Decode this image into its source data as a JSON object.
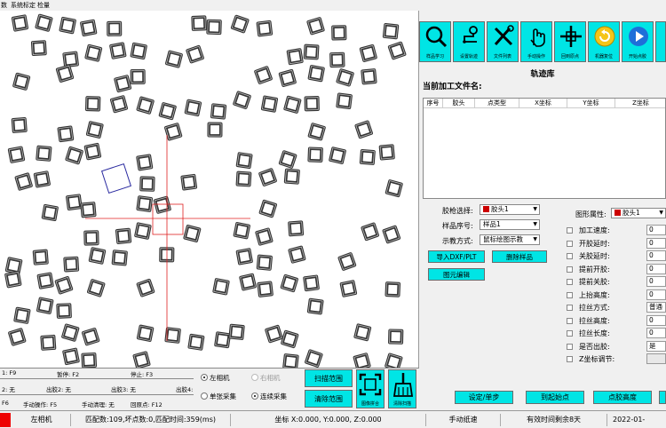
{
  "menu": {
    "items": [
      "数",
      "系统标定",
      "检量"
    ]
  },
  "info": {
    "row1": [
      "1: F9",
      "暂停: F2",
      "停止: F3"
    ],
    "row2": [
      "2: 无",
      "出胶2: 无",
      "出胶3: 无",
      "出胶4:"
    ],
    "row3": [
      "F6",
      "手动操作: F5",
      "手动清理: 无",
      "回原点: F12"
    ]
  },
  "camera_options": {
    "left_camera": "左相机",
    "right_camera": "右相机",
    "single_capture": "单张采集",
    "continuous_capture": "连续采集"
  },
  "buttons": {
    "scan_range": "扫描范围",
    "clear_range": "清除范围",
    "image_stitch": "图像拼合",
    "clear_scan": "清除扫描",
    "import_dxf": "导入DXF/PLT",
    "delete_sample": "删除样品",
    "edit_element": "图元编辑",
    "set_step": "设定/单步",
    "to_start": "到起始点",
    "glue_height": "点胶高度"
  },
  "toolbar": [
    {
      "label": "样品学习",
      "icon": "search-icon"
    },
    {
      "label": "设置轨迹",
      "icon": "route-icon"
    },
    {
      "label": "文件列表",
      "icon": "tools-icon"
    },
    {
      "label": "手动操作",
      "icon": "hand-icon"
    },
    {
      "label": "回到原点",
      "icon": "crosshair-icon"
    },
    {
      "label": "机器复位",
      "icon": "reset-icon"
    },
    {
      "label": "开始点胶",
      "icon": "play-icon"
    }
  ],
  "track": {
    "title": "轨迹库",
    "file_label": "当前加工文件名:",
    "columns": [
      "序号",
      "胶头",
      "点类型",
      "X坐标",
      "Y坐标",
      "Z坐标"
    ]
  },
  "form": {
    "glue_gun_label": "胶枪选择:",
    "glue_gun_value": "胶头1",
    "sample_no_label": "样品序号:",
    "sample_no_value": "样品1",
    "display_mode_label": "示教方式:",
    "display_mode_value": "鼠标绘图示教",
    "shape_attr_label": "图形属性:",
    "shape_attr_value": "胶头1"
  },
  "params": [
    {
      "label": "加工速度:",
      "value": "0"
    },
    {
      "label": "开胶延时:",
      "value": "0"
    },
    {
      "label": "关胶延时:",
      "value": "0"
    },
    {
      "label": "提前开胶:",
      "value": "0"
    },
    {
      "label": "提前关胶:",
      "value": "0"
    },
    {
      "label": "上抬高度:",
      "value": "0"
    },
    {
      "label": "拉丝方式:",
      "value": "普通"
    },
    {
      "label": "拉丝高度:",
      "value": "0"
    },
    {
      "label": "拉丝长度:",
      "value": "0"
    },
    {
      "label": "是否出胶:",
      "value": "是"
    },
    {
      "label": "Z坐标调节:",
      "value": ""
    }
  ],
  "status": {
    "camera": "左相机",
    "match": "匹配数:109,坏点数:0,匹配时间:359(ms)",
    "coords": "坐标 X:0.000, Y:0.000, Z:0.000",
    "mode": "手动纸速",
    "license": "有效时间剩余8天",
    "date": "2022-01-"
  },
  "colors": {
    "accent": "#00e5e5",
    "crosshair": "#e02020",
    "glue_swatch": "#cc0000"
  }
}
